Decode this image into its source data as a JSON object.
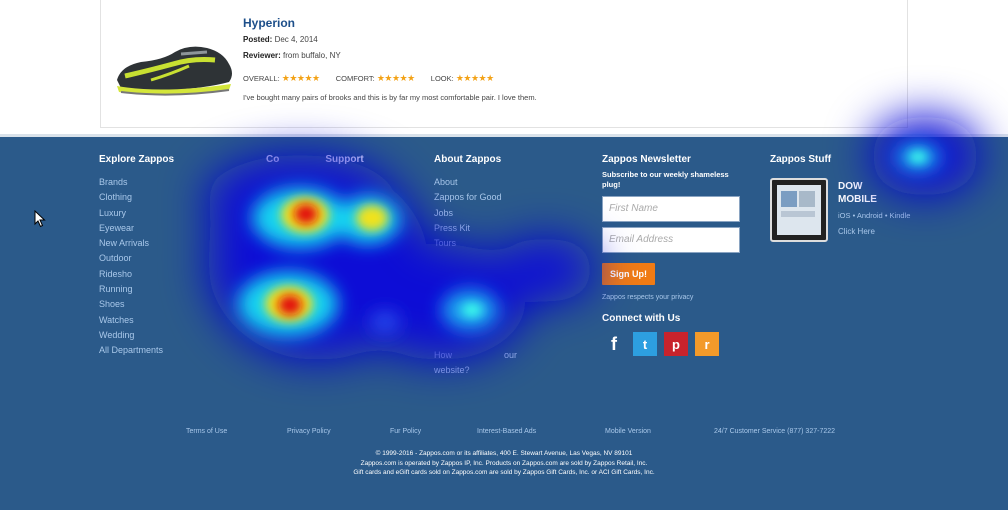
{
  "review": {
    "title": "Hyperion",
    "posted_label": "Posted:",
    "posted_value": "Dec 4, 2014",
    "reviewer_label": "Reviewer:",
    "reviewer_value": "from buffalo, NY",
    "overall_label": "OVERALL:",
    "comfort_label": "COMFORT:",
    "look_label": "LOOK:",
    "stars": "★★★★★",
    "text": "I've bought many pairs of brooks and this is by far my most comfortable pair. I love them."
  },
  "footer": {
    "explore": {
      "title": "Explore Zappos",
      "items": [
        "Brands",
        "Clothing",
        "Luxury",
        "Eyewear",
        "New Arrivals",
        "Outdoor",
        "Ridesho",
        "Running",
        "Shoes",
        "Watches",
        "Wedding",
        "All Departments"
      ]
    },
    "customer": {
      "title_a": "Co",
      "title_b": "Support"
    },
    "about": {
      "title": "About Zappos",
      "items": [
        "About",
        "Zappos for Good",
        "Jobs",
        "Press Kit",
        "Tours"
      ],
      "last_line1": "How",
      "last_line2": "our",
      "last_line3": "website?"
    },
    "newsletter": {
      "title": "Zappos Newsletter",
      "subtitle": "Subscribe to our weekly shameless plug!",
      "first_placeholder": "First Name",
      "email_placeholder": "Email Address",
      "signup": "Sign Up!",
      "privacy": "Zappos respects your privacy",
      "connect": "Connect with Us",
      "social": {
        "facebook": "f",
        "twitter": "t",
        "pinterest": "p",
        "rss": "r"
      }
    },
    "stuff": {
      "title": "Zappos Stuff",
      "app_line1": "DOW",
      "app_line2": "MOBILE",
      "platforms": "iOS • Android • Kindle",
      "click": "Click Here"
    },
    "bottom_links": [
      "Terms of Use",
      "Privacy Policy",
      "Fur Policy",
      "Interest-Based Ads",
      "Mobile Version",
      "24/7 Customer Service (877) 327-7222"
    ],
    "copyright": [
      "© 1999-2016 - Zappos.com or its affiliates, 400 E. Stewart Avenue, Las Vegas, NV 89101",
      "Zappos.com is operated by Zappos IP, Inc. Products on Zappos.com are sold by Zappos Retail, Inc.",
      "Gift cards and eGift cards sold on Zappos.com are sold by Zappos Gift Cards, Inc. or ACI Gift Cards, Inc."
    ]
  },
  "colors": {
    "footer_bg": "#2b5a8a",
    "link": "#a9c8ea",
    "signup": "#f07b14"
  }
}
